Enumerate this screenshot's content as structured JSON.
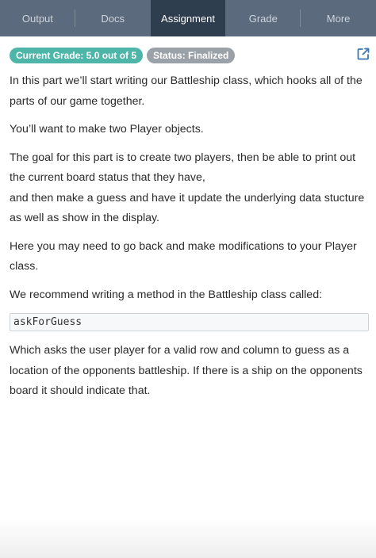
{
  "tabs": [
    {
      "label": "Output"
    },
    {
      "label": "Docs"
    },
    {
      "label": "Assignment"
    },
    {
      "label": "Grade"
    },
    {
      "label": "More"
    }
  ],
  "active_tab": "Assignment",
  "badges": {
    "grade": "Current Grade: 5.0 out of 5",
    "status": "Status: Finalized"
  },
  "icons": {
    "external_link": "external-link-icon"
  },
  "colors": {
    "tabbar": "#5b6b7d",
    "active_tab": "#2f3e4e",
    "grade_badge": "#4eb5a9",
    "status_badge": "#9aa1a8",
    "link_icon": "#3a78b5"
  },
  "content": {
    "p1": "In this part we’ll start writing our Battleship class, which hooks all of the parts of our game together.",
    "p2": "You’ll want to make two Player objects.",
    "p3a": "The goal for this part is to create two players, then be able to print out the current board status that they have,",
    "p3b": "and then make a guess and have it update the underlying data stucture as well as show in the display.",
    "p4": "Here you may need to go back and make modifications to your Player class.",
    "p5": "We recommend writing a method in the Battleship class called:",
    "code": "askForGuess",
    "p6": "Which asks the user player for a valid row and column to guess as a location of the opponents battleship. If there is a ship on the opponents board it should indicate that."
  }
}
